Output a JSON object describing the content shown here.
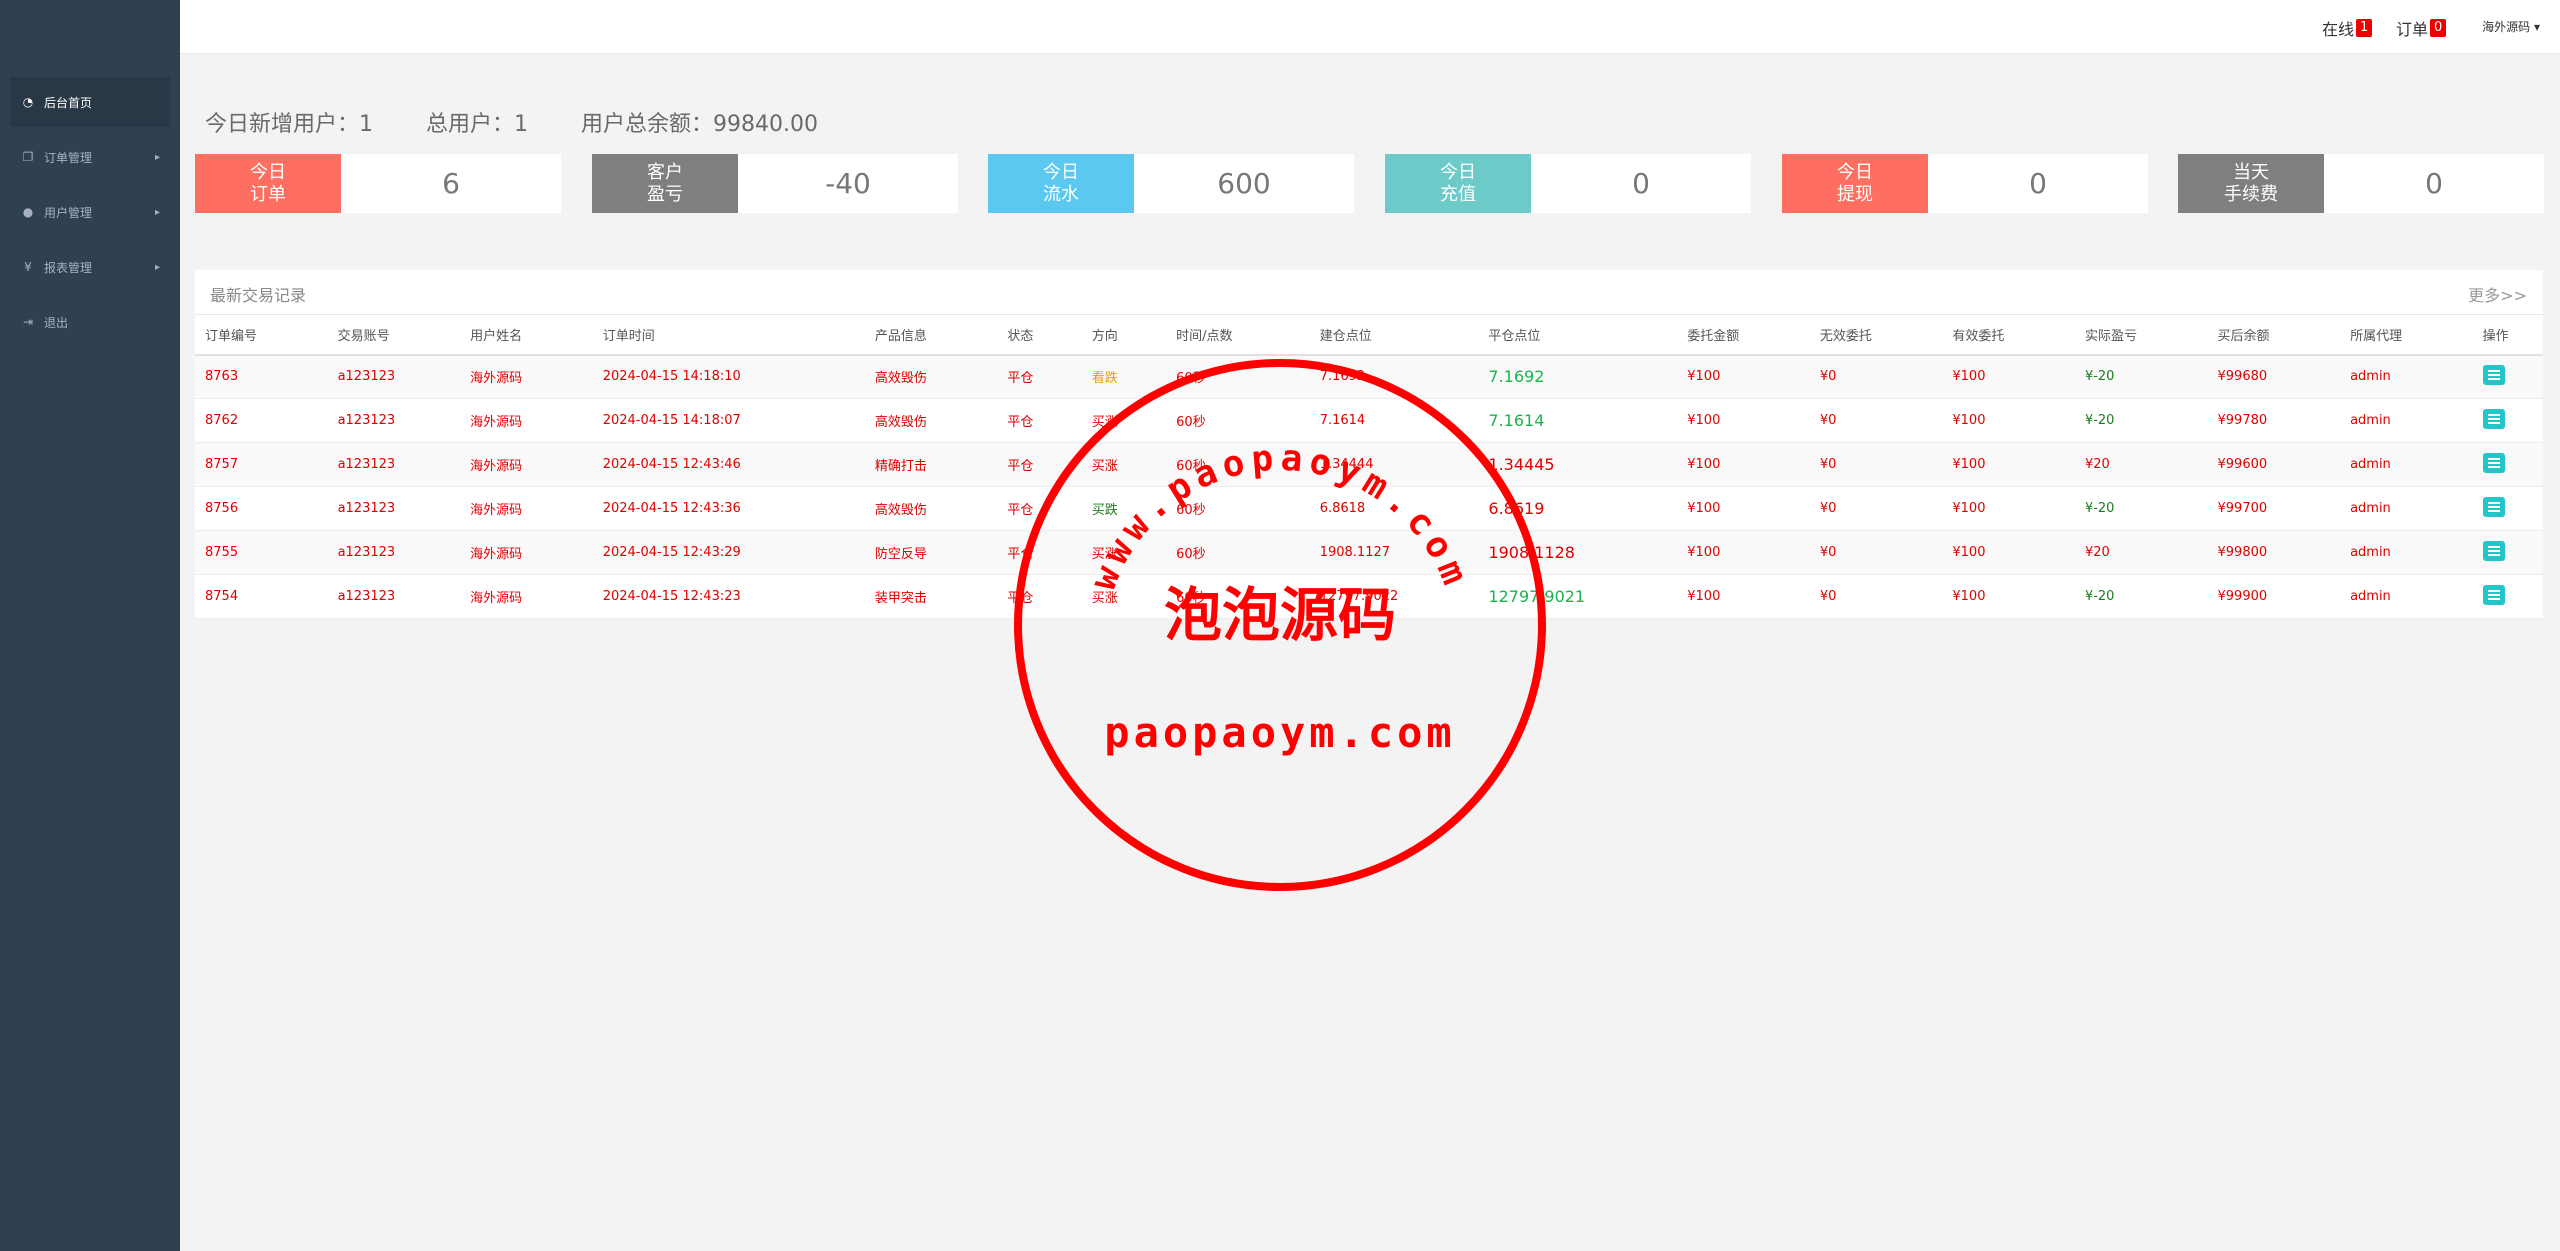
{
  "sidebar": {
    "items": [
      {
        "label": "后台首页",
        "icon": "dashboard-icon",
        "active": true
      },
      {
        "label": "订单管理",
        "icon": "order-icon"
      },
      {
        "label": "用户管理",
        "icon": "user-icon"
      },
      {
        "label": "报表管理",
        "icon": "yen-icon"
      },
      {
        "label": "退出",
        "icon": "logout-icon"
      }
    ]
  },
  "topbar": {
    "online_label": "在线",
    "online_count": "1",
    "order_label": "订单",
    "order_count": "0",
    "user_name": "海外源码 ▾"
  },
  "summary": {
    "new_users": "今日新增用户：1",
    "total_users": "总用户：1",
    "total_balance": "用户总余额：99840.00"
  },
  "cards": [
    {
      "label": "今日\n订单",
      "value": "6",
      "color": "#ff6f61"
    },
    {
      "label": "客户\n盈亏",
      "value": "-40",
      "color": "#7f7f7f"
    },
    {
      "label": "今日\n流水",
      "value": "600",
      "color": "#5bc8f0"
    },
    {
      "label": "今日\n充值",
      "value": "0",
      "color": "#6ccac9"
    },
    {
      "label": "今日\n提现",
      "value": "0",
      "color": "#ff6f61"
    },
    {
      "label": "当天\n手续费",
      "value": "0",
      "color": "#7f7f7f"
    }
  ],
  "panel": {
    "title": "最新交易记录",
    "more": "更多>>",
    "columns": [
      "订单编号",
      "交易账号",
      "用户姓名",
      "订单时间",
      "产品信息",
      "状态",
      "方向",
      "时间/点数",
      "建仓点位",
      "平仓点位",
      "委托金额",
      "无效委托",
      "有效委托",
      "实际盈亏",
      "买后余额",
      "所属代理",
      "操作"
    ],
    "rows": [
      [
        "8763",
        "a123123",
        "海外源码",
        "2024-04-15 14:18:10",
        "高效毁伤",
        "平仓",
        "看跌",
        "60秒",
        "7.1692",
        "7.1692",
        "¥100",
        "¥0",
        "¥100",
        "¥-20",
        "¥99680",
        "admin"
      ],
      [
        "8762",
        "a123123",
        "海外源码",
        "2024-04-15 14:18:07",
        "高效毁伤",
        "平仓",
        "买涨",
        "60秒",
        "7.1614",
        "7.1614",
        "¥100",
        "¥0",
        "¥100",
        "¥-20",
        "¥99780",
        "admin"
      ],
      [
        "8757",
        "a123123",
        "海外源码",
        "2024-04-15 12:43:46",
        "精确打击",
        "平仓",
        "买涨",
        "60秒",
        "1.34444",
        "1.34445",
        "¥100",
        "¥0",
        "¥100",
        "¥20",
        "¥99600",
        "admin"
      ],
      [
        "8756",
        "a123123",
        "海外源码",
        "2024-04-15 12:43:36",
        "高效毁伤",
        "平仓",
        "买跌",
        "60秒",
        "6.8618",
        "6.8619",
        "¥100",
        "¥0",
        "¥100",
        "¥-20",
        "¥99700",
        "admin"
      ],
      [
        "8755",
        "a123123",
        "海外源码",
        "2024-04-15 12:43:29",
        "防空反导",
        "平仓",
        "买涨",
        "60秒",
        "1908.1127",
        "1908.1128",
        "¥100",
        "¥0",
        "¥100",
        "¥20",
        "¥99800",
        "admin"
      ],
      [
        "8754",
        "a123123",
        "海外源码",
        "2024-04-15 12:43:23",
        "装甲突击",
        "平仓",
        "买涨",
        "60秒",
        "12797.9022",
        "12797.9021",
        "¥100",
        "¥0",
        "¥100",
        "¥-20",
        "¥99900",
        "admin"
      ]
    ]
  },
  "stamp": {
    "arc_text": "www.paopaoym.com",
    "center_text": "泡泡源码",
    "bottom_text": "paopaoym.com",
    "color": "#ff0000"
  }
}
